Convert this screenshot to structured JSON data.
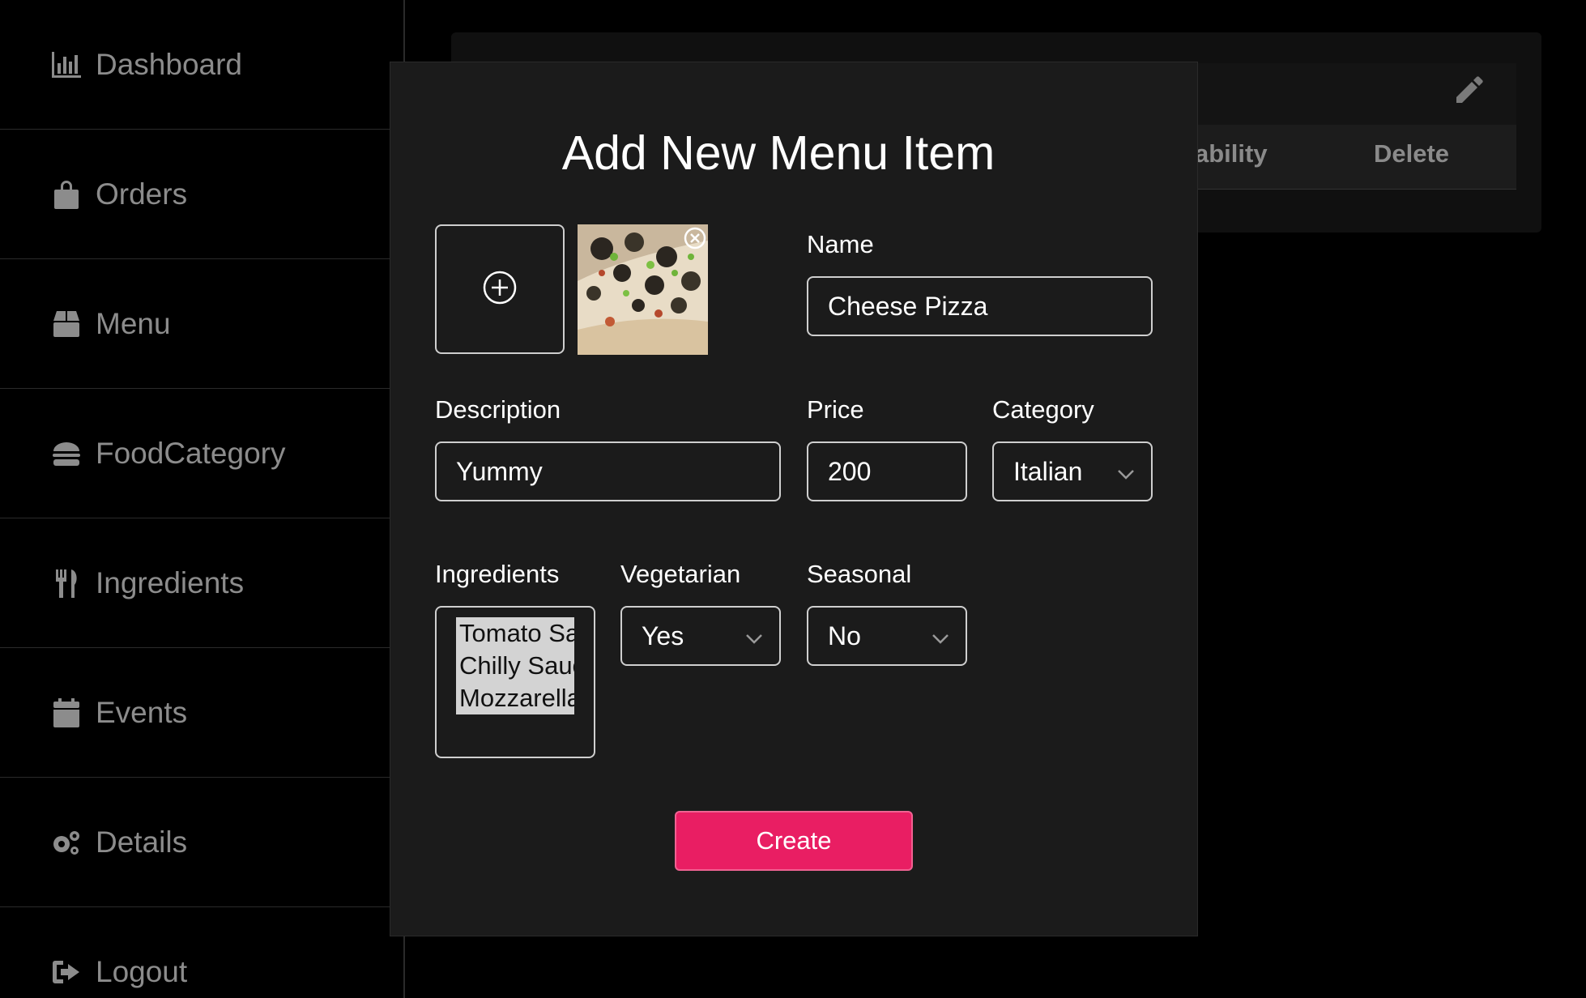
{
  "sidebar": {
    "items": [
      {
        "label": "Dashboard",
        "icon": "chart-bar-icon"
      },
      {
        "label": "Orders",
        "icon": "shopping-bag-icon"
      },
      {
        "label": "Menu",
        "icon": "box-icon"
      },
      {
        "label": "FoodCategory",
        "icon": "burger-icon"
      },
      {
        "label": "Ingredients",
        "icon": "utensils-icon"
      },
      {
        "label": "Events",
        "icon": "calendar-icon"
      },
      {
        "label": "Details",
        "icon": "gears-icon"
      },
      {
        "label": "Logout",
        "icon": "logout-icon"
      }
    ]
  },
  "background_table": {
    "columns": [
      "ability",
      "Delete"
    ],
    "edit_icon": "pencil-icon"
  },
  "modal": {
    "title": "Add New Menu Item",
    "upload_icon": "plus-circle-icon",
    "remove_photo_icon": "close-circle-icon",
    "name": {
      "label": "Name",
      "value": "Cheese Pizza"
    },
    "description": {
      "label": "Description",
      "value": "Yummy"
    },
    "price": {
      "label": "Price",
      "value": "200"
    },
    "category": {
      "label": "Category",
      "value": "Italian"
    },
    "ingredients": {
      "label": "Ingredients",
      "options": [
        "Tomato Sauce",
        "Chilly Sauce",
        "Mozzarella"
      ]
    },
    "vegetarian": {
      "label": "Vegetarian",
      "value": "Yes"
    },
    "seasonal": {
      "label": "Seasonal",
      "value": "No"
    },
    "create_label": "Create"
  },
  "colors": {
    "accent": "#e91e63",
    "background": "#000000",
    "modal_bg": "#1b1b1b",
    "sidebar_text": "#8c8c8c"
  }
}
